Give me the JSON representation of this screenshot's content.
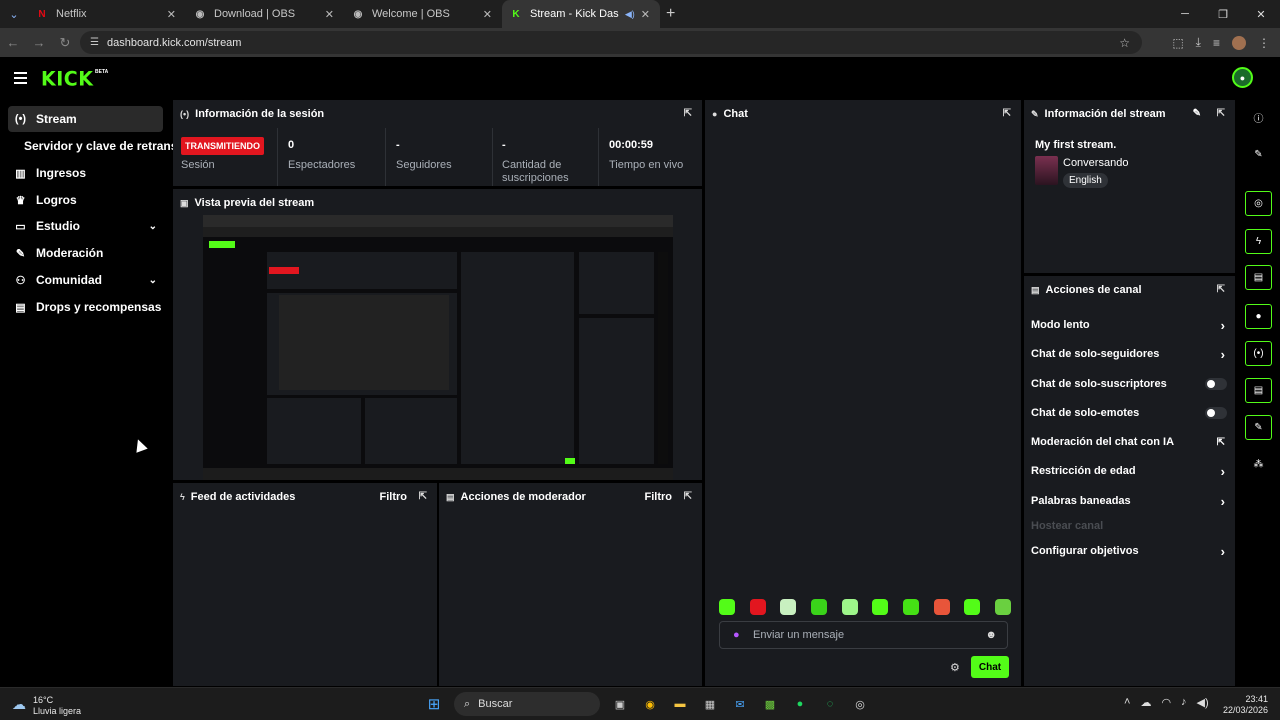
{
  "browser": {
    "tabs": [
      {
        "title": "Netflix",
        "favicon": "N"
      },
      {
        "title": "Download | OBS",
        "favicon": "◉"
      },
      {
        "title": "Welcome | OBS",
        "favicon": "◉"
      },
      {
        "title": "Stream - Kick Dashboard",
        "favicon": "K"
      }
    ],
    "url": "dashboard.kick.com/stream"
  },
  "kick": {
    "logo": "KICK",
    "beta": "BETA"
  },
  "sidebar": {
    "items": [
      {
        "label": "Stream",
        "icon": "broadcast-icon"
      },
      {
        "label": "Servidor y clave de retransmisión",
        "icon": ""
      },
      {
        "label": "Ingresos",
        "icon": "chart-icon"
      },
      {
        "label": "Logros",
        "icon": "trophy-icon"
      },
      {
        "label": "Estudio",
        "icon": "studio-icon"
      },
      {
        "label": "Moderación",
        "icon": "wrench-icon"
      },
      {
        "label": "Comunidad",
        "icon": "people-icon"
      },
      {
        "label": "Drops y recompensas",
        "icon": "drops-icon"
      }
    ]
  },
  "session": {
    "title": "Información de la sesión",
    "status_badge": "TRANSMITIENDO",
    "stats": [
      {
        "value": "",
        "label": "Sesión"
      },
      {
        "value": "0",
        "label": "Espectadores"
      },
      {
        "value": "-",
        "label": "Seguidores"
      },
      {
        "value": "-",
        "label": "Cantidad de suscripciones"
      },
      {
        "value": "00:00:59",
        "label": "Tiempo en vivo"
      }
    ]
  },
  "preview": {
    "title": "Vista previa del stream"
  },
  "activity": {
    "title": "Feed de actividades",
    "filter": "Filtro"
  },
  "modactions": {
    "title": "Acciones de moderador",
    "filter": "Filtro"
  },
  "chat": {
    "title": "Chat",
    "placeholder": "Enviar un mensaje",
    "send_label": "Chat"
  },
  "stream_info": {
    "title": "Información del stream",
    "stream_title": "My first stream.",
    "category": "Conversando",
    "language": "English"
  },
  "channel_actions": {
    "title": "Acciones de canal",
    "items": [
      {
        "label": "Modo lento"
      },
      {
        "label": "Chat de solo-seguidores"
      },
      {
        "label": "Chat de solo-suscriptores"
      },
      {
        "label": "Chat de solo-emotes"
      },
      {
        "label": "Moderación del chat con IA"
      },
      {
        "label": "Restricción de edad"
      },
      {
        "label": "Palabras baneadas"
      },
      {
        "label": "Hostear canal"
      },
      {
        "label": "Configurar objetivos"
      }
    ]
  },
  "taskbar": {
    "temp": "16°C",
    "weather": "Lluvia ligera",
    "search": "Buscar",
    "time": "23:41",
    "date": "22/03/2026"
  },
  "colors": {
    "accent": "#53fc18",
    "live": "#e2161f",
    "panel": "#191b1f"
  }
}
